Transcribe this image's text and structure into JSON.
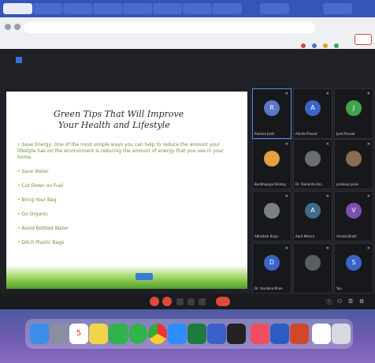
{
  "browser": {
    "tabs": [
      "",
      "",
      "",
      "",
      "",
      "",
      "",
      "",
      "",
      ""
    ],
    "url": "",
    "bookmarks": [
      "",
      "",
      "",
      "",
      "",
      "",
      "",
      ""
    ],
    "profile_label": ""
  },
  "meeting": {
    "title": "",
    "time": "",
    "slide": {
      "title_line1": "Green Tips That Will Improve",
      "title_line2": "Your Health and Lifestyle",
      "bullets": [
        "Save Energy: One of the most simple ways you can help to reduce the amount your lifestyle has on the environment is reducing the amount of energy that you use in your home.",
        "Save Water",
        "Cut Down on Fuel",
        "Bring Your Bag",
        "Go Organic",
        "Avoid Bottled Water",
        "Ditch Plastic Bags"
      ],
      "footer": ""
    },
    "participants": [
      {
        "name": "Rachna Joshi",
        "initial": "R",
        "color": "#5b79c9"
      },
      {
        "name": "Ankita Prasad",
        "initial": "A",
        "color": "#3b64c8"
      },
      {
        "name": "Jyoti Prasad",
        "initial": "J",
        "color": "#3fa34d"
      },
      {
        "name": "Buddhapuja Shimoy",
        "initial": "",
        "color": "#e2a23b"
      },
      {
        "name": "Dr. Alankrita Har...",
        "initial": "",
        "color": "#6a6d74"
      },
      {
        "name": "pradeep jainsi",
        "initial": "",
        "color": "#8a6c52"
      },
      {
        "name": "Abhishek Rojan",
        "initial": "",
        "color": "#7a7f86"
      },
      {
        "name": "Aarti Mishra",
        "initial": "A",
        "color": "#3e6a8a"
      },
      {
        "name": "Vrinda Bhatt",
        "initial": "V",
        "color": "#7b4fb0"
      },
      {
        "name": "Dr. Vandana Khan",
        "initial": "D",
        "color": "#3b64c8"
      },
      {
        "name": "",
        "initial": "",
        "color": "#5a5d63"
      },
      {
        "name": "You",
        "initial": "S",
        "color": "#3b64c8"
      }
    ]
  },
  "dock": {
    "apps": [
      {
        "icon": "finder-icon",
        "color": "#3b8fe8"
      },
      {
        "icon": "launchpad-icon",
        "color": "#8a8fa0"
      },
      {
        "icon": "calendar-icon",
        "color": "#ffffff",
        "label": "5"
      },
      {
        "icon": "notes-icon",
        "color": "#f2d34a"
      },
      {
        "icon": "facetime-icon",
        "color": "#2fb34a"
      },
      {
        "icon": "whatsapp-icon",
        "color": "#2fb34a"
      },
      {
        "icon": "chrome-icon",
        "color": "#e8e8e8"
      },
      {
        "icon": "zoom-icon",
        "color": "#2d8cff"
      },
      {
        "icon": "excel-icon",
        "color": "#1f7a3f"
      },
      {
        "icon": "app-icon",
        "color": "#3b5fc8"
      },
      {
        "icon": "tv-icon",
        "color": "#222222"
      },
      {
        "icon": "music-icon",
        "color": "#f04e5e"
      },
      {
        "icon": "word-icon",
        "color": "#2b5cc4"
      },
      {
        "icon": "powerpoint-icon",
        "color": "#d2472a"
      },
      {
        "icon": "onenote-icon",
        "color": "#ffffff"
      },
      {
        "icon": "trash-icon",
        "color": "#d8dadf"
      }
    ]
  }
}
